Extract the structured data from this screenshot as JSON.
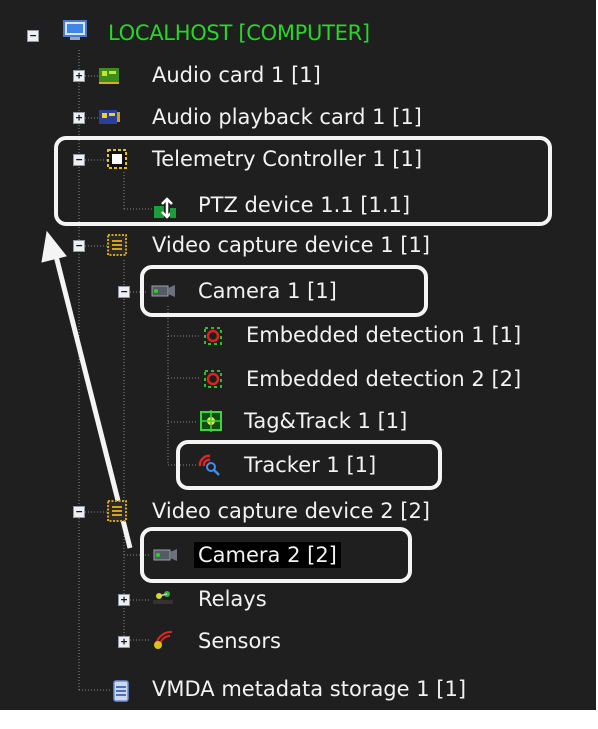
{
  "tree": {
    "root": {
      "label": "LOCALHOST [COMPUTER]",
      "toggle": "−"
    },
    "items": [
      {
        "label": "Audio card 1 [1]",
        "toggle": "+"
      },
      {
        "label": "Audio playback card 1 [1]",
        "toggle": "+"
      },
      {
        "label": "Telemetry Controller 1 [1]",
        "toggle": "−"
      },
      {
        "label": "PTZ device 1.1 [1.1]"
      },
      {
        "label": "Video capture device 1 [1]",
        "toggle": "−"
      },
      {
        "label": "Camera 1 [1]",
        "toggle": "−"
      },
      {
        "label": "Embedded detection 1 [1]"
      },
      {
        "label": "Embedded detection 2 [2]"
      },
      {
        "label": "Tag&Track 1 [1]"
      },
      {
        "label": "Tracker 1 [1]"
      },
      {
        "label": "Video capture device 2 [2]",
        "toggle": "−"
      },
      {
        "label": "Camera 2 [2]",
        "selected": true
      },
      {
        "label": "Relays",
        "toggle": "+"
      },
      {
        "label": "Sensors",
        "toggle": "+"
      },
      {
        "label": "VMDA metadata storage 1 [1]"
      }
    ]
  },
  "colors": {
    "background": "#1f1f1f",
    "root_text": "#27d627",
    "text": "#f2f2f2",
    "highlight": "#f4f4f4"
  },
  "icons": [
    "computer-icon",
    "audio-card-icon",
    "audio-playback-card-icon",
    "telemetry-controller-icon",
    "ptz-device-icon",
    "video-capture-icon",
    "camera-icon",
    "detection-icon",
    "tagtrack-icon",
    "tracker-icon",
    "relay-icon",
    "sensor-icon",
    "storage-icon"
  ]
}
